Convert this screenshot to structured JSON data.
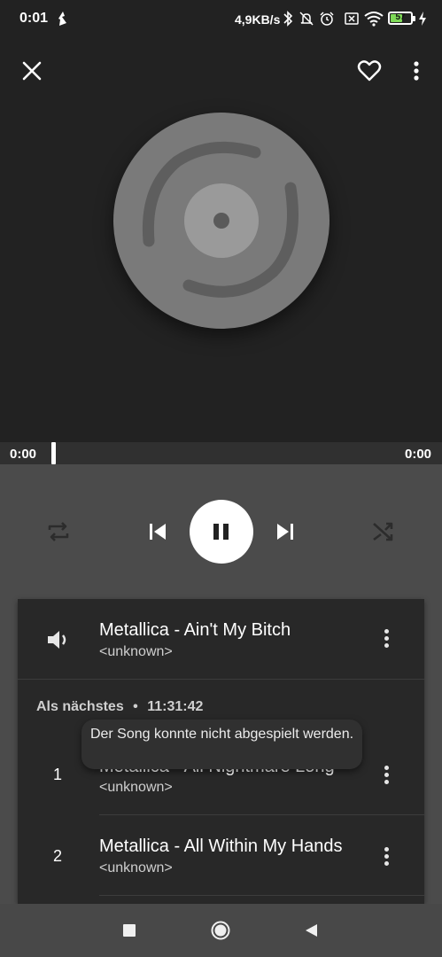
{
  "status_bar": {
    "time": "0:01",
    "network_speed": "4,9KB/s",
    "battery_level": "57",
    "battery_fraction": 0.57,
    "battery_color": "#7ed957",
    "icons": [
      "notification-app-icon",
      "bluetooth-icon",
      "mute-icon",
      "alarm-icon",
      "sim-off-icon",
      "wifi-icon",
      "battery-icon",
      "charging-icon"
    ]
  },
  "top_bar": {
    "icons": [
      "close-icon",
      "heart-icon",
      "more-vert-icon"
    ]
  },
  "player": {
    "current_time": "0:00",
    "total_time": "0:00",
    "progress": 0.0,
    "icons": [
      "repeat-icon",
      "previous-icon",
      "pause-icon",
      "next-icon",
      "shuffle-icon"
    ]
  },
  "now_playing": {
    "title": "Metallica - Ain't My Bitch",
    "artist": "<unknown>",
    "icon": "speaker-icon"
  },
  "queue": {
    "header_label": "Als nächstes",
    "separator": "•",
    "duration": "11:31:42",
    "items": [
      {
        "index": "1",
        "title": "Metallica - All Nightmare Long",
        "artist": "<unknown>"
      },
      {
        "index": "2",
        "title": "Metallica - All Within My Hands",
        "artist": "<unknown>"
      }
    ]
  },
  "toast": {
    "message": "Der Song konnte nicht abgespielt werden."
  },
  "nav_bar": {
    "icons": [
      "recents-icon",
      "home-icon",
      "back-icon"
    ]
  },
  "colors": {
    "background": "#222222",
    "controls_bg": "#4b4b4b",
    "panel_bg": "#282828",
    "disc": "#7a7a7a"
  }
}
